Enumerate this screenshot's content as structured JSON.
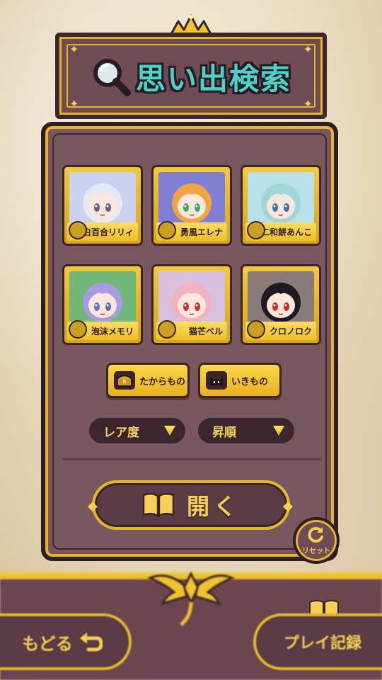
{
  "title": "思い出検索",
  "characters": [
    {
      "name": "白百合リリィ",
      "bg": "#c9d2ee",
      "hair": "#e8e8f4",
      "eye": "#6a5a8a"
    },
    {
      "name": "勇風エレナ",
      "bg": "#7f7fd6",
      "hair": "#f2a440",
      "eye": "#3aa85a"
    },
    {
      "name": "二和餅あんこ",
      "bg": "#b7e0ea",
      "hair": "#9fd7d9",
      "eye": "#3c6fa8"
    },
    {
      "name": "泡沫メモリ",
      "bg": "#6fb87a",
      "hair": "#a99be0",
      "eye": "#5a6fc8"
    },
    {
      "name": "猫芒ベル",
      "bg": "#d8c0e0",
      "hair": "#f2b2c0",
      "eye": "#c83232"
    },
    {
      "name": "クロノロク",
      "bg": "#8a7a7a",
      "hair": "#1e1a22",
      "eye": "#d02828"
    }
  ],
  "filters": {
    "treasure": "たからもの",
    "creature": "いきもの"
  },
  "sort": {
    "rarity": "レア度",
    "order": "昇順"
  },
  "open_label": "開く",
  "reset_label": "リセット",
  "bottom": {
    "back_label": "もどる",
    "record_label": "プレイ記録"
  },
  "colors": {
    "panel": "#7a5560",
    "gold": "#e7b628",
    "dark": "#2f1d25",
    "title_teal": "#4ed1c6"
  }
}
